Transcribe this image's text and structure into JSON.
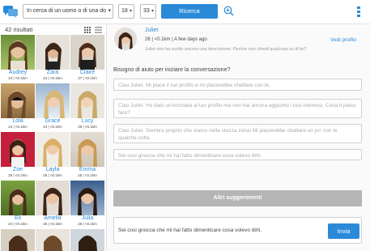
{
  "topbar": {
    "search_value": "In cerca di un uomo o di una do",
    "age_min": "18",
    "age_max": "33",
    "search_button": "Ricerca",
    "accent": "#2b8ad8"
  },
  "results": {
    "count_label": "42 risultati",
    "profiles": [
      {
        "name": "Audrey",
        "meta": "24 | <0.1km"
      },
      {
        "name": "Zara",
        "meta": "24 | <0.1km"
      },
      {
        "name": "Claire",
        "meta": "27 | <0.1km"
      },
      {
        "name": "Lola",
        "meta": "24 | <0.1km"
      },
      {
        "name": "Grace",
        "meta": "24 | <0.1km"
      },
      {
        "name": "Lucy",
        "meta": "25 | <0.1km"
      },
      {
        "name": "Zoe",
        "meta": "25 | <0.1km"
      },
      {
        "name": "Layla",
        "meta": "25 | <0.1km"
      },
      {
        "name": "Emma",
        "meta": "25 | <0.1km"
      },
      {
        "name": "Eli",
        "meta": "24 | <0.1km"
      },
      {
        "name": "Amelia",
        "meta": "26 | <0.1km"
      },
      {
        "name": "Julia",
        "meta": "26 | <0.1km"
      },
      {
        "name": "",
        "meta": ""
      },
      {
        "name": "",
        "meta": ""
      },
      {
        "name": "",
        "meta": ""
      }
    ]
  },
  "profile": {
    "name": "Juliet",
    "meta": "26 | <0.1km | A few days ago",
    "description": "Juliet non ha scritto ancora una descrizione. Perche non chiedi qualcosa su di lei?",
    "view_profile": "Vedi profilo"
  },
  "chat": {
    "help_label": "Bisogno di aiuto per iniziare la conversazione?",
    "suggestions": [
      "Ciao Juliet. Mi piace il tuo profilo e mi piacerebbe chattare con te.",
      "Ciao Juliet. Ho dato un'occhiata al tuo profilo ma non hai ancora aggiunto i tuoi interessi. Cosa ti piace fare?",
      "Ciao Juliet. Sembra proprio che siamo nella stezza zona! Mi piacerebbe chattare un po' con te qualche volta.",
      "Sei cosi gnocca che mi hai fatto dimenticare cosa volevo dirti."
    ],
    "more_button": "Altri suggerimenti",
    "compose_value": "Sei cosi gnocca che mi hai fatto dimenticare cosa volevo dirti.",
    "send_button": "Invia"
  },
  "icons": [
    "chat-logo-icon",
    "chevron-down-icon",
    "zoom-icon",
    "kebab-menu-icon",
    "grid-view-icon",
    "list-view-icon"
  ]
}
